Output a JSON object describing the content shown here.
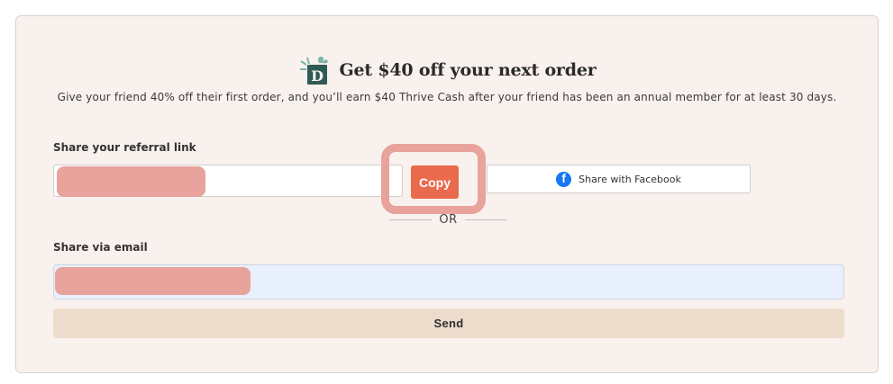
{
  "header": {
    "icon": "gift-icon",
    "title": "Get $40 off your next order",
    "subtitle": "Give your friend 40% off their first order, and you’ll earn $40 Thrive Cash after your friend has been an annual member for at least 30 days."
  },
  "referral": {
    "label": "Share your referral link",
    "link_value": "",
    "copy_label": "Copy",
    "facebook_label": "Share with Facebook",
    "facebook_icon": "facebook-icon"
  },
  "divider": {
    "or_text": "OR"
  },
  "email": {
    "label": "Share via email",
    "value": "",
    "send_label": "Send"
  },
  "colors": {
    "card_bg": "#f9f1ed",
    "copy_button": "#ea6a4d",
    "send_button": "#eddccc",
    "email_input_bg": "#e8f0fe",
    "facebook_blue": "#1877f2",
    "redaction": "#e7a39c"
  }
}
